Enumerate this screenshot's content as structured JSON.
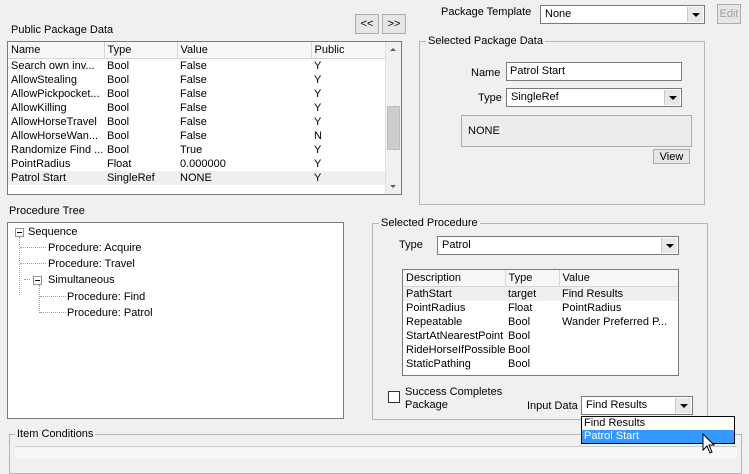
{
  "public_package_data": {
    "title": "Public Package Data",
    "prev_button": "<<",
    "next_button": ">>",
    "columns": [
      "Name",
      "Type",
      "Value",
      "Public"
    ],
    "rows": [
      {
        "name": "Search own inv...",
        "type": "Bool",
        "value": "False",
        "public": "Y"
      },
      {
        "name": "AllowStealing",
        "type": "Bool",
        "value": "False",
        "public": "Y"
      },
      {
        "name": "AllowPickpocket...",
        "type": "Bool",
        "value": "False",
        "public": "Y"
      },
      {
        "name": "AllowKilling",
        "type": "Bool",
        "value": "False",
        "public": "Y"
      },
      {
        "name": "AllowHorseTravel",
        "type": "Bool",
        "value": "False",
        "public": "Y"
      },
      {
        "name": "AllowHorseWan...",
        "type": "Bool",
        "value": "False",
        "public": "N"
      },
      {
        "name": "Randomize Find ...",
        "type": "Bool",
        "value": "True",
        "public": "Y"
      },
      {
        "name": "PointRadius",
        "type": "Float",
        "value": "0.000000",
        "public": "Y"
      },
      {
        "name": "Patrol Start",
        "type": "SingleRef",
        "value": " NONE",
        "public": "Y"
      }
    ],
    "selected_row": 8
  },
  "package_template": {
    "label": "Package Template",
    "value": "None",
    "edit_button": "Edit"
  },
  "selected_package_data": {
    "title": "Selected Package Data",
    "name_label": "Name",
    "name_value": "Patrol Start",
    "type_label": "Type",
    "type_value": "SingleRef",
    "ref_value": "NONE",
    "view_button": "View"
  },
  "procedure_tree": {
    "title": "Procedure Tree",
    "items": [
      {
        "label": "Sequence"
      },
      {
        "label": "Procedure: Acquire"
      },
      {
        "label": "Procedure: Travel"
      },
      {
        "label": "Simultaneous"
      },
      {
        "label": "Procedure: Find"
      },
      {
        "label": "Procedure: Patrol"
      }
    ]
  },
  "selected_procedure": {
    "title": "Selected Procedure",
    "type_label": "Type",
    "type_value": "Patrol",
    "columns": [
      "Description",
      "Type",
      "Value"
    ],
    "rows": [
      {
        "description": "PathStart",
        "type": "target",
        "value": "Find Results"
      },
      {
        "description": "PointRadius",
        "type": "Float",
        "value": "PointRadius"
      },
      {
        "description": "Repeatable",
        "type": "Bool",
        "value": "Wander Preferred P..."
      },
      {
        "description": "StartAtNearestPoint",
        "type": "Bool",
        "value": ""
      },
      {
        "description": "RideHorseIfPossible",
        "type": "Bool",
        "value": ""
      },
      {
        "description": "StaticPathing",
        "type": "Bool",
        "value": ""
      }
    ],
    "selected_row": 0,
    "success_completes_label": "Success Completes\nPackage",
    "input_data_label": "Input Data",
    "input_data_value": "Find Results",
    "input_data_options": [
      "Find Results",
      "Patrol Start"
    ],
    "input_data_highlighted": 1
  },
  "item_conditions": {
    "title": "Item Conditions"
  }
}
